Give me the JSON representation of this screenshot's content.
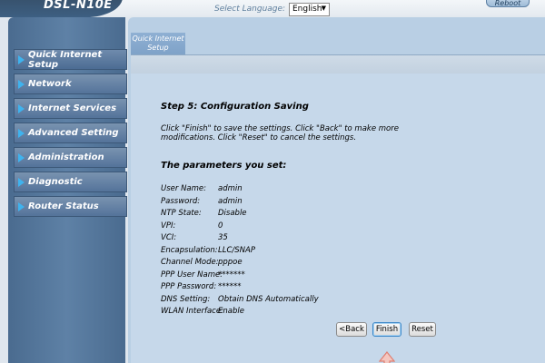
{
  "header": {
    "model": "DSL-N10E",
    "language_label": "Select Language:",
    "language_value": "English",
    "reboot_label": "Reboot"
  },
  "sidebar": {
    "items": [
      {
        "label": "Quick Internet Setup"
      },
      {
        "label": "Network"
      },
      {
        "label": "Internet Services"
      },
      {
        "label": "Advanced Setting"
      },
      {
        "label": "Administration"
      },
      {
        "label": "Diagnostic"
      },
      {
        "label": "Router Status"
      }
    ]
  },
  "main": {
    "tab_line1": "Quick Internet",
    "tab_line2": "Setup",
    "step_title": "Step 5: Configuration Saving",
    "instructions": "Click \"Finish\" to save the settings. Click \"Back\" to make more modifications. Click \"Reset\" to cancel the settings.",
    "params_title": "The parameters you set:",
    "params": [
      {
        "label": "User Name:",
        "value": "admin"
      },
      {
        "label": "Password:",
        "value": "admin"
      },
      {
        "label": "NTP State:",
        "value": "Disable"
      },
      {
        "label": "VPI:",
        "value": "0"
      },
      {
        "label": "VCI:",
        "value": "35"
      },
      {
        "label": "Encapsulation:",
        "value": "LLC/SNAP"
      },
      {
        "label": "Channel Mode:",
        "value": "pppoe"
      },
      {
        "label": "PPP User Name:",
        "value": "*******"
      },
      {
        "label": "PPP Password:",
        "value": "******"
      },
      {
        "label": "DNS Setting:",
        "value": "Obtain DNS Automatically"
      },
      {
        "label": "WLAN Interface:",
        "value": "Enable"
      }
    ],
    "buttons": {
      "back": "<Back",
      "finish": "Finish",
      "reset": "Reset"
    }
  },
  "colors": {
    "accent": "#3fb3ee",
    "panel": "#c6d8ea",
    "sidebar": "#4a6b8f",
    "pointer": "#f4c7c0"
  },
  "icons": {
    "nav_bullet": "triangle-right-icon",
    "language_dropdown": "chevron-down-icon",
    "pointer": "up-arrow-icon"
  }
}
